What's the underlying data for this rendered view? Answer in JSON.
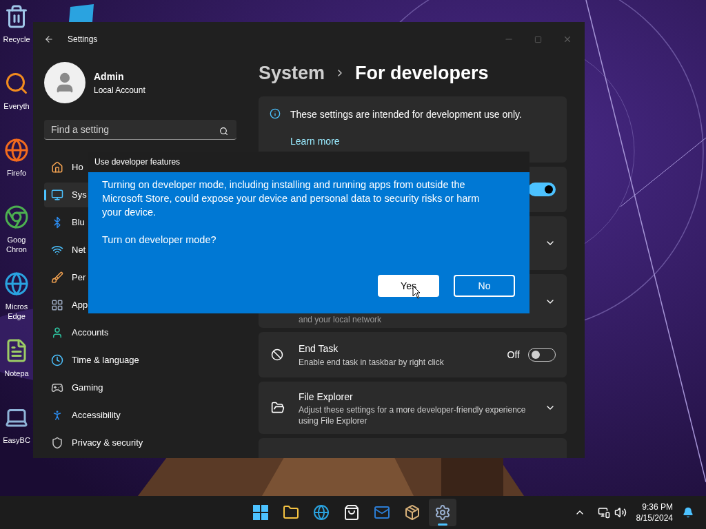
{
  "desktop": {
    "icons": [
      {
        "lines": [
          "Recycle"
        ]
      },
      {
        "lines": [
          "Everyth"
        ]
      },
      {
        "lines": [
          "Firefo"
        ]
      },
      {
        "lines": [
          "Goog",
          "Chron"
        ]
      },
      {
        "lines": [
          "Micros",
          "Edge"
        ]
      },
      {
        "lines": [
          "Notepa"
        ]
      },
      {
        "lines": [
          "EasyBC"
        ]
      }
    ]
  },
  "settings_window": {
    "title": "Settings",
    "user": {
      "name": "Admin",
      "account_type": "Local Account"
    },
    "search": {
      "placeholder": "Find a setting"
    },
    "nav": [
      {
        "label": "Ho",
        "selected": false
      },
      {
        "label": "Sys",
        "selected": true
      },
      {
        "label": "Blu",
        "selected": false
      },
      {
        "label": "Net",
        "selected": false
      },
      {
        "label": "Per",
        "selected": false
      },
      {
        "label": "App",
        "selected": false
      },
      {
        "label": "Accounts",
        "selected": false
      },
      {
        "label": "Time & language",
        "selected": false
      },
      {
        "label": "Gaming",
        "selected": false
      },
      {
        "label": "Accessibility",
        "selected": false
      },
      {
        "label": "Privacy & security",
        "selected": false
      }
    ],
    "breadcrumb": [
      "System",
      "For developers"
    ],
    "cards": [
      {
        "kind": "info",
        "text": "These settings are intended for development use only.",
        "link": "Learn more"
      },
      {
        "kind": "toggle",
        "on": true
      },
      {
        "kind": "expander"
      },
      {
        "kind": "expander",
        "description": "and your local network"
      },
      {
        "kind": "toggle",
        "title": "End Task",
        "description": "Enable end task in taskbar by right click",
        "state_label": "Off",
        "on": false
      },
      {
        "kind": "expander",
        "title": "File Explorer",
        "description": "Adjust these settings for a more developer-friendly experience using File Explorer"
      },
      {
        "kind": "partial"
      }
    ]
  },
  "dialog": {
    "title": "Use developer features",
    "message": "Turning on developer mode, including installing and running apps from outside the Microsoft Store, could expose your device and personal data to security risks or harm your device.",
    "question": "Turn on developer mode?",
    "buttons": [
      {
        "label": "Yes",
        "kind": "primary"
      },
      {
        "label": "No",
        "kind": "secondary"
      }
    ]
  },
  "taskbar": {
    "apps": [
      {
        "selected": false
      },
      {
        "selected": false
      },
      {
        "selected": false
      },
      {
        "selected": false
      },
      {
        "selected": false
      },
      {
        "selected": false
      },
      {
        "selected": true
      }
    ],
    "clock": {
      "time": "9:36 PM",
      "date": "8/15/2024"
    }
  }
}
